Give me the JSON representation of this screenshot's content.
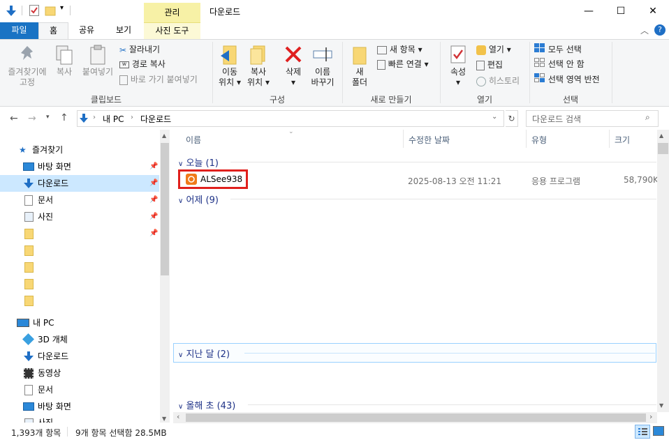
{
  "titlebar": {
    "context_tab_head": "관리",
    "window_title": "다운로드",
    "minimize": "—",
    "maximize": "☐",
    "close": "✕"
  },
  "ribbon_tabs": {
    "file": "파일",
    "home": "홈",
    "share": "공유",
    "view": "보기",
    "app_tools": "사진 도구"
  },
  "ribbon": {
    "clipboard": {
      "pin_line1": "즐겨찾기에",
      "pin_line2": "고정",
      "copy": "복사",
      "paste": "붙여넣기",
      "cut": "잘라내기",
      "copy_path": "경로 복사",
      "paste_shortcut": "바로 가기 붙여넣기",
      "label": "클립보드"
    },
    "organize": {
      "move_to_line1": "이동",
      "move_to_line2": "위치",
      "copy_to_line1": "복사",
      "copy_to_line2": "위치",
      "delete": "삭제",
      "rename_line1": "이름",
      "rename_line2": "바꾸기",
      "label": "구성"
    },
    "new": {
      "new_folder_line1": "새",
      "new_folder_line2": "폴더",
      "new_item": "새 항목",
      "easy_access": "빠른 연결",
      "label": "새로 만들기"
    },
    "open": {
      "properties": "속성",
      "open": "열기",
      "edit": "편집",
      "history": "히스토리",
      "label": "열기"
    },
    "select": {
      "select_all": "모두 선택",
      "select_none": "선택 안 함",
      "invert": "선택 영역 반전",
      "label": "선택"
    }
  },
  "address": {
    "crumb_pc": "내 PC",
    "crumb_downloads": "다운로드",
    "search_placeholder": "다운로드 검색"
  },
  "nav": {
    "quick_access": "즐겨찾기",
    "desktop": "바탕 화면",
    "downloads": "다운로드",
    "documents": "문서",
    "pictures": "사진",
    "this_pc": "내 PC",
    "objects3d": "3D 개체",
    "pc_downloads": "다운로드",
    "videos": "동영상",
    "pc_documents": "문서",
    "pc_desktop": "바탕 화면",
    "pc_pictures": "사진"
  },
  "columns": {
    "name": "이름",
    "date": "수정한 날짜",
    "type": "유형",
    "size": "크기"
  },
  "groups": {
    "today": "오늘 (1)",
    "yesterday": "어제 (9)",
    "last_month": "지난 달 (2)",
    "early_year": "올해 초 (43)"
  },
  "file": {
    "name": "ALSee938",
    "date": "2025-08-13 오전 11:21",
    "type": "응용 프로그램",
    "size": "58,790K"
  },
  "status": {
    "count": "1,393개 항목",
    "selected": "9개 항목 선택함 28.5MB"
  },
  "colors": {
    "accent": "#1a73c4",
    "context_yellow": "#f7f1a6",
    "selection": "#cce8ff",
    "highlight_box": "#e0201c"
  }
}
